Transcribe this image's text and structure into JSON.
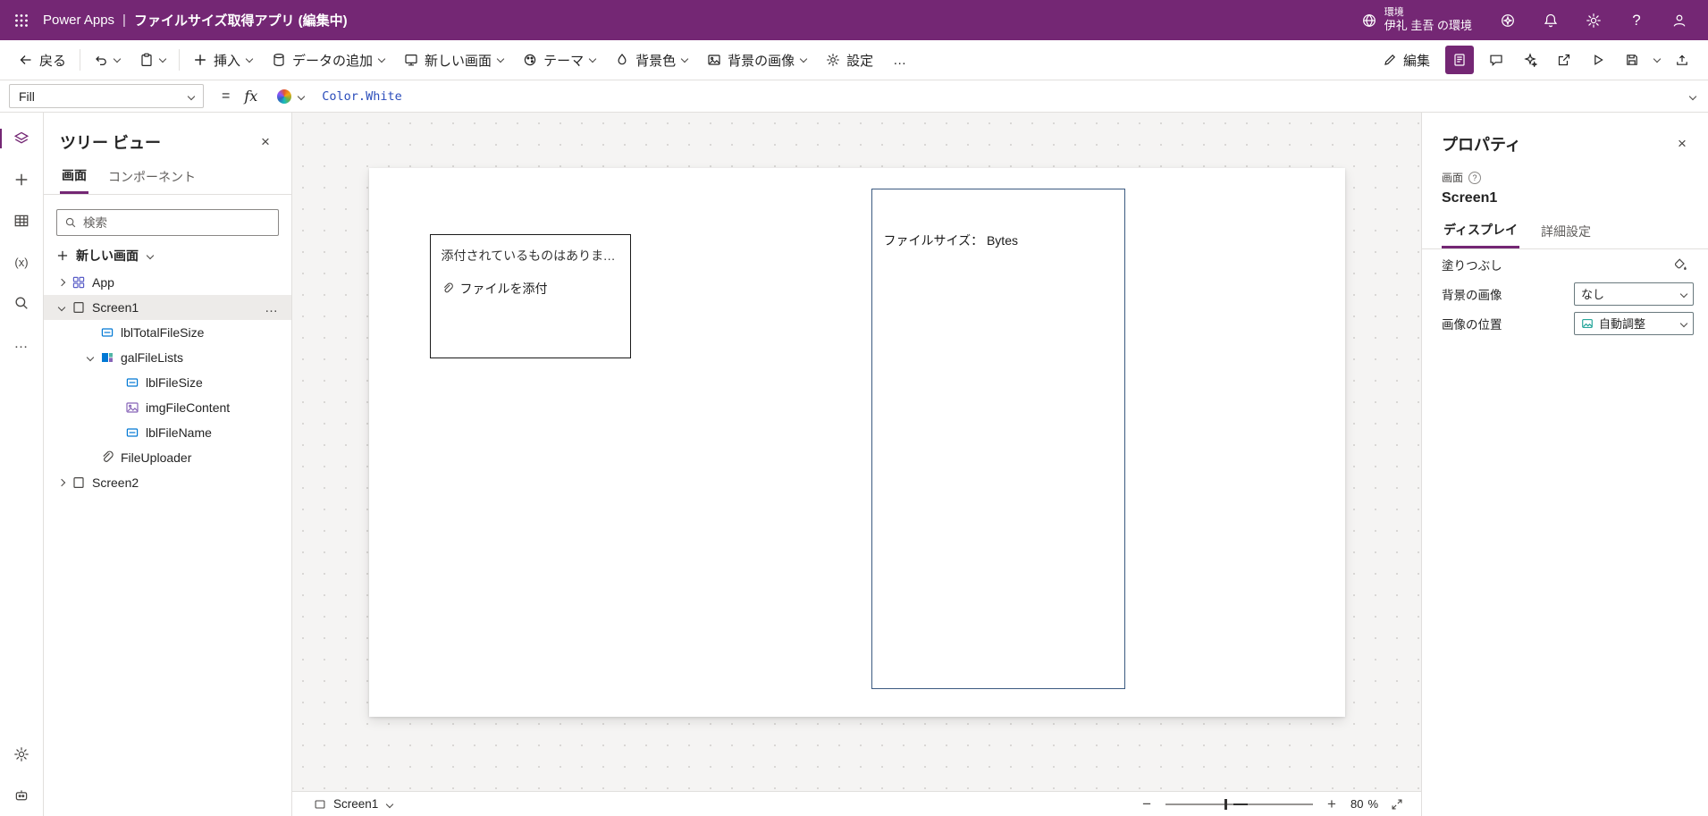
{
  "ui": {
    "divider": "|",
    "close": "×",
    "overflow": "…",
    "equals": "=",
    "fx": "fx",
    "minus": "−",
    "plus": "+",
    "percent": "%",
    "help": "?",
    "variables": "(x)"
  },
  "colors": {
    "brand_purple": "#742774",
    "formula_text_blue": "#2b4dbb",
    "gallery_border_blue": "#3b5a80"
  },
  "header": {
    "app_name": "Power Apps",
    "title": "ファイルサイズ取得アプリ (編集中)",
    "environment_label": "環境",
    "environment_name": "伊礼 圭吾 の環境"
  },
  "command_bar": {
    "back": "戻る",
    "insert": "挿入",
    "add_data": "データの追加",
    "new_screen": "新しい画面",
    "theme": "テーマ",
    "background_color": "背景色",
    "background_image": "背景の画像",
    "settings": "設定",
    "edit": "編集"
  },
  "formula_bar": {
    "property": "Fill",
    "formula": "Color.White"
  },
  "tree_panel": {
    "title": "ツリー ビュー",
    "tabs": [
      {
        "label": "画面"
      },
      {
        "label": "コンポーネント"
      }
    ],
    "search_placeholder": "検索",
    "new_screen_label": "新しい画面",
    "items": [
      {
        "label": "App"
      },
      {
        "label": "Screen1"
      },
      {
        "label": "lblTotalFileSize"
      },
      {
        "label": "galFileLists"
      },
      {
        "label": "lblFileSize"
      },
      {
        "label": "imgFileContent"
      },
      {
        "label": "lblFileName"
      },
      {
        "label": "FileUploader"
      },
      {
        "label": "Screen2"
      }
    ]
  },
  "canvas": {
    "attachment": {
      "empty_text": "添付されているものはありませ...",
      "attach_label": "ファイルを添付"
    },
    "gallery_label": "ファイルサイズ： Bytes"
  },
  "properties_panel": {
    "title": "プロパティ",
    "object_type": "画面",
    "object_name": "Screen1",
    "tabs": [
      {
        "label": "ディスプレイ"
      },
      {
        "label": "詳細設定"
      }
    ],
    "fields": [
      {
        "label": "塗りつぶし"
      },
      {
        "label": "背景の画像",
        "value": "なし"
      },
      {
        "label": "画像の位置",
        "value": "自動調整"
      }
    ]
  },
  "status_bar": {
    "screen_name": "Screen1",
    "zoom_value": "80"
  }
}
